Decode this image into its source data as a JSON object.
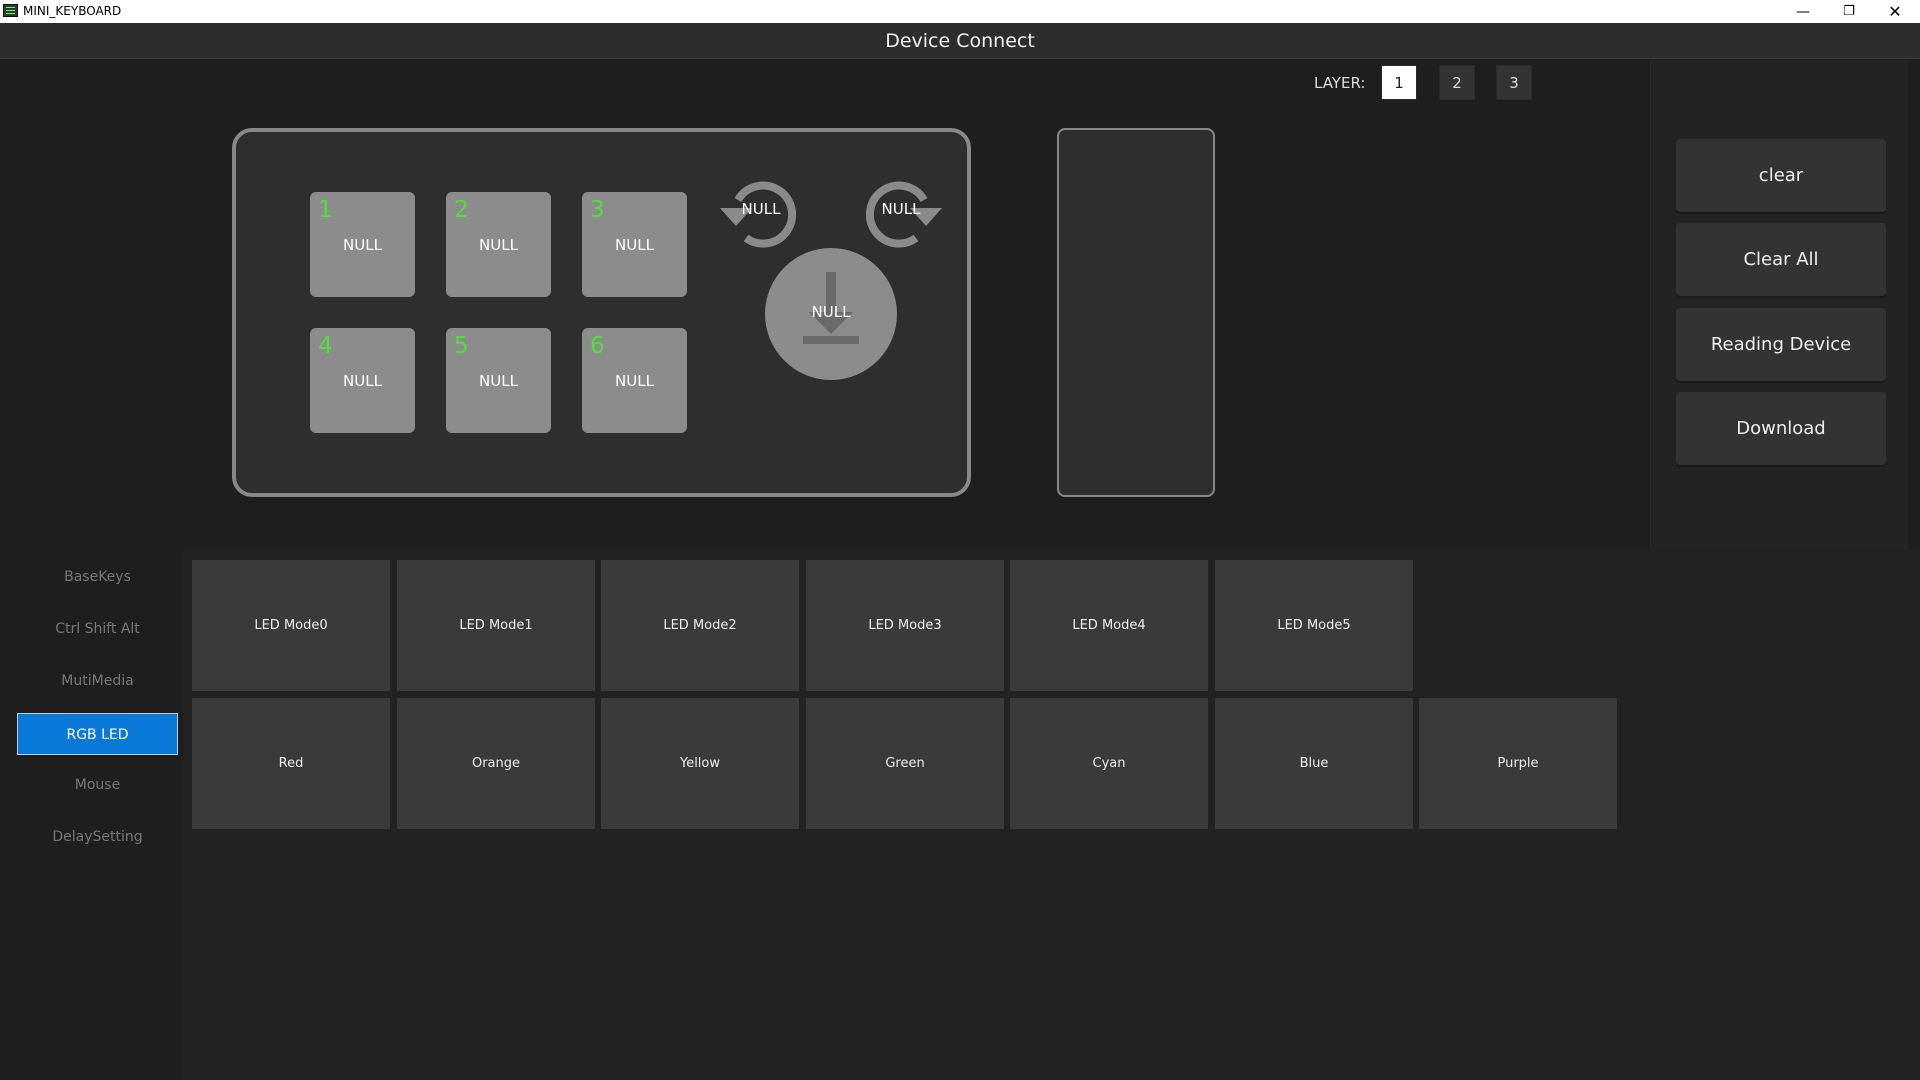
{
  "window": {
    "title": "MINI_KEYBOARD",
    "minimize_glyph": "—",
    "maximize_glyph": "❐",
    "close_glyph": "✕"
  },
  "header": {
    "title": "Device Connect"
  },
  "layers": {
    "label": "LAYER:",
    "items": [
      "1",
      "2",
      "3"
    ],
    "active": "1"
  },
  "keyboard": {
    "keys": [
      {
        "number": "1",
        "label": "NULL"
      },
      {
        "number": "2",
        "label": "NULL"
      },
      {
        "number": "3",
        "label": "NULL"
      },
      {
        "number": "4",
        "label": "NULL"
      },
      {
        "number": "5",
        "label": "NULL"
      },
      {
        "number": "6",
        "label": "NULL"
      }
    ],
    "knob": {
      "rotate_left": "NULL",
      "rotate_right": "NULL",
      "press": "NULL"
    }
  },
  "actions": {
    "clear": "clear",
    "clear_all": "Clear All",
    "reading_device": "Reading Device",
    "download": "Download"
  },
  "nav": {
    "items": [
      "BaseKeys",
      "Ctrl Shift Alt",
      "MutiMedia",
      "RGB LED",
      "Mouse",
      "DelaySetting"
    ],
    "active": "RGB LED"
  },
  "rgb_led": {
    "modes": [
      "LED Mode0",
      "LED Mode1",
      "LED Mode2",
      "LED Mode3",
      "LED Mode4",
      "LED Mode5"
    ],
    "colors": [
      "Red",
      "Orange",
      "Yellow",
      "Green",
      "Cyan",
      "Blue",
      "Purple"
    ]
  },
  "theme": {
    "key_number_color": "#52e03c",
    "accent": "#0a78d7",
    "background": "#1e1e1e"
  },
  "icons": {
    "app": "keyboard-app-icon",
    "knob_left": "rotate-counterclockwise-icon",
    "knob_right": "rotate-clockwise-icon",
    "knob_press": "press-down-icon"
  }
}
